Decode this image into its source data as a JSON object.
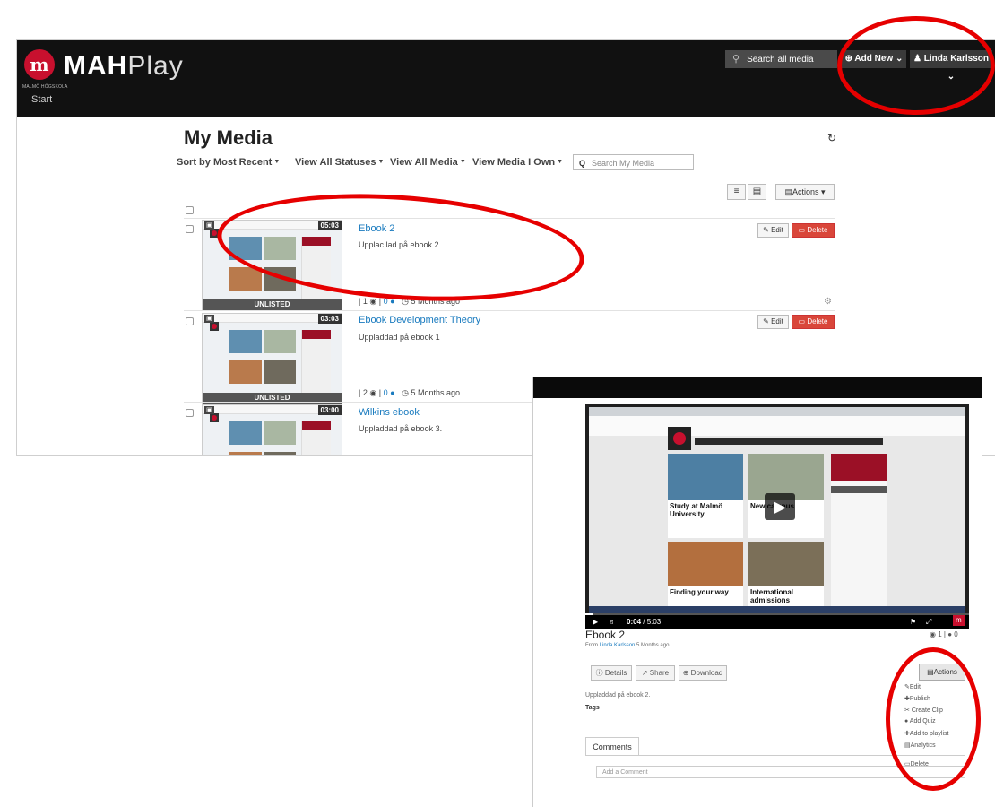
{
  "brand": {
    "bold": "MAH",
    "light": "Play",
    "mark": "m",
    "org_small": "MALMÖ HÖGSKOLA"
  },
  "nav": {
    "start": "Start"
  },
  "header": {
    "search_placeholder": "Search all media",
    "add_new": "Add New",
    "user": "Linda Karlsson"
  },
  "page": {
    "title": "My Media"
  },
  "filters": [
    "Sort by Most Recent",
    "View All Statuses",
    "View All Media",
    "View Media I Own"
  ],
  "search_my_placeholder": "Search My Media",
  "actions_label": "Actions",
  "row_buttons": {
    "edit": "Edit",
    "delete": "Delete"
  },
  "media_items": [
    {
      "title": "Ebook 2",
      "description": "Upplac  lad  på ebook 2.",
      "duration": "05:03",
      "status": "UNLISTED",
      "plays": "1",
      "comments": "0",
      "age": "5 Months ago"
    },
    {
      "title": "Ebook Development Theory",
      "description": "Uppladdad på ebook 1",
      "duration": "03:03",
      "status": "UNLISTED",
      "plays": "2",
      "comments": "0",
      "age": "5 Months ago"
    },
    {
      "title": "Wilkins ebook",
      "description": "Uppladdad på ebook 3.",
      "duration": "03:00"
    }
  ],
  "player": {
    "time_current": "0:04",
    "time_total": "5:03",
    "title": "Ebook 2",
    "from_prefix": "From",
    "owner": "Linda Karlsson",
    "age": "5 Months ago",
    "views": "1",
    "comment_count": "0",
    "buttons": {
      "details": "Details",
      "share": "Share",
      "download": "Download",
      "actions": "Actions"
    },
    "description": "Uppladdad på ebook 2.",
    "tags_label": "Tags",
    "menu": [
      "Edit",
      "Publish",
      "Create Clip",
      "Add Quiz",
      "Add to playlist",
      "Analytics",
      "Delete"
    ],
    "comments_tab": "Comments",
    "comment_placeholder": "Add a Comment",
    "video_text": {
      "study": "Study at Malmö University",
      "finding": "Finding your way",
      "intl": "International admissions",
      "campus": "New campus"
    }
  },
  "annotation_color": "#e60000",
  "accent_color": "#c8102e"
}
